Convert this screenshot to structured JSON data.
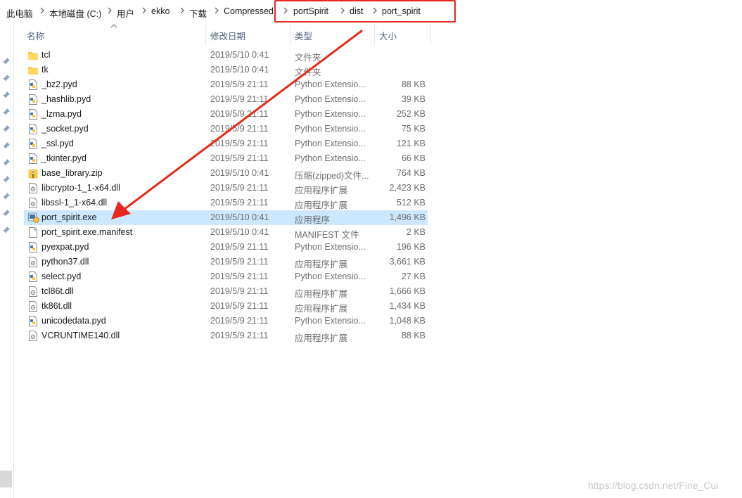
{
  "breadcrumb": {
    "items": [
      "此电脑",
      "本地磁盘 (C:)",
      "用户",
      "ekko",
      "下载",
      "Compressed",
      "portSpirit",
      "dist",
      "port_spirit"
    ]
  },
  "columns": {
    "name": "名称",
    "date": "修改日期",
    "type": "类型",
    "size": "大小"
  },
  "files": [
    {
      "name": "tcl",
      "date": "2019/5/10 0:41",
      "type": "文件夹",
      "size": "",
      "icon": "folder-icon"
    },
    {
      "name": "tk",
      "date": "2019/5/10 0:41",
      "type": "文件夹",
      "size": "",
      "icon": "folder-icon"
    },
    {
      "name": "_bz2.pyd",
      "date": "2019/5/9 21:11",
      "type": "Python Extensio...",
      "size": "88 KB",
      "icon": "python-file-icon"
    },
    {
      "name": "_hashlib.pyd",
      "date": "2019/5/9 21:11",
      "type": "Python Extensio...",
      "size": "39 KB",
      "icon": "python-file-icon"
    },
    {
      "name": "_lzma.pyd",
      "date": "2019/5/9 21:11",
      "type": "Python Extensio...",
      "size": "252 KB",
      "icon": "python-file-icon"
    },
    {
      "name": "_socket.pyd",
      "date": "2019/5/9 21:11",
      "type": "Python Extensio...",
      "size": "75 KB",
      "icon": "python-file-icon"
    },
    {
      "name": "_ssl.pyd",
      "date": "2019/5/9 21:11",
      "type": "Python Extensio...",
      "size": "121 KB",
      "icon": "python-file-icon"
    },
    {
      "name": "_tkinter.pyd",
      "date": "2019/5/9 21:11",
      "type": "Python Extensio...",
      "size": "66 KB",
      "icon": "python-file-icon"
    },
    {
      "name": "base_library.zip",
      "date": "2019/5/10 0:41",
      "type": "压缩(zipped)文件...",
      "size": "764 KB",
      "icon": "zip-icon"
    },
    {
      "name": "libcrypto-1_1-x64.dll",
      "date": "2019/5/9 21:11",
      "type": "应用程序扩展",
      "size": "2,423 KB",
      "icon": "dll-icon"
    },
    {
      "name": "libssl-1_1-x64.dll",
      "date": "2019/5/9 21:11",
      "type": "应用程序扩展",
      "size": "512 KB",
      "icon": "dll-icon"
    },
    {
      "name": "port_spirit.exe",
      "date": "2019/5/10 0:41",
      "type": "应用程序",
      "size": "1,496 KB",
      "icon": "exe-icon",
      "selected": true
    },
    {
      "name": "port_spirit.exe.manifest",
      "date": "2019/5/10 0:41",
      "type": "MANIFEST 文件",
      "size": "2 KB",
      "icon": "blank-file-icon"
    },
    {
      "name": "pyexpat.pyd",
      "date": "2019/5/9 21:11",
      "type": "Python Extensio...",
      "size": "196 KB",
      "icon": "python-file-icon"
    },
    {
      "name": "python37.dll",
      "date": "2019/5/9 21:11",
      "type": "应用程序扩展",
      "size": "3,661 KB",
      "icon": "dll-icon"
    },
    {
      "name": "select.pyd",
      "date": "2019/5/9 21:11",
      "type": "Python Extensio...",
      "size": "27 KB",
      "icon": "python-file-icon"
    },
    {
      "name": "tcl86t.dll",
      "date": "2019/5/9 21:11",
      "type": "应用程序扩展",
      "size": "1,666 KB",
      "icon": "dll-icon"
    },
    {
      "name": "tk86t.dll",
      "date": "2019/5/9 21:11",
      "type": "应用程序扩展",
      "size": "1,434 KB",
      "icon": "dll-icon"
    },
    {
      "name": "unicodedata.pyd",
      "date": "2019/5/9 21:11",
      "type": "Python Extensio...",
      "size": "1,048 KB",
      "icon": "python-file-icon"
    },
    {
      "name": "VCRUNTIME140.dll",
      "date": "2019/5/9 21:11",
      "type": "应用程序扩展",
      "size": "88 KB",
      "icon": "dll-icon"
    }
  ],
  "colors": {
    "selection": "#cce8ff",
    "annotation": "#e8281f",
    "header_text": "#4c607a"
  },
  "watermark": "https://blog.csdn.net/Fine_Cui"
}
